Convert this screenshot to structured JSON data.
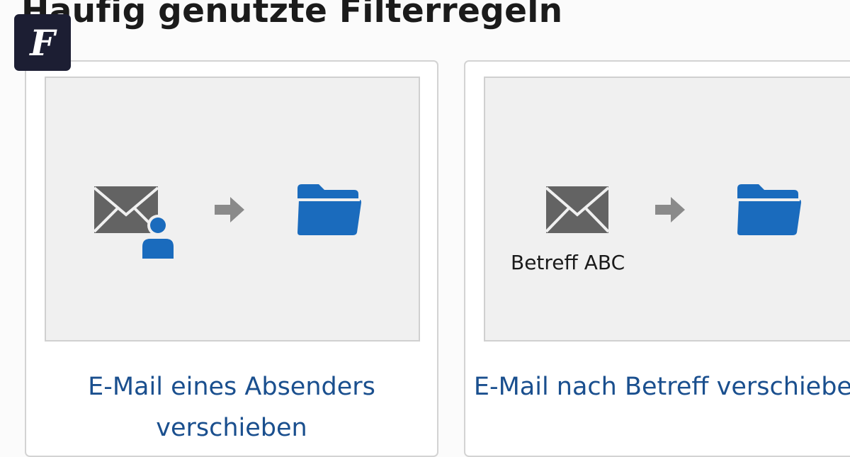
{
  "page": {
    "heading": "Häufig genutzte Filterregeln"
  },
  "logo": {
    "letter": "F",
    "icon": "faz-logo-icon"
  },
  "rules": [
    {
      "title": "E-Mail eines Absenders verschieben",
      "icons": [
        "envelope-icon",
        "person-icon",
        "arrow-right-icon",
        "folder-icon"
      ]
    },
    {
      "title": "E-Mail nach Betreff verschieben",
      "subject_label": "Betreff ABC",
      "icons": [
        "envelope-icon",
        "arrow-right-icon",
        "folder-icon"
      ]
    }
  ],
  "colors": {
    "heading": "#1b1b1b",
    "rule_title": "#1a4f8e",
    "icon_gray": "#636363",
    "arrow_gray": "#8a8a8a",
    "icon_blue": "#1a6bbd",
    "logo_bg": "#1c1e33"
  }
}
